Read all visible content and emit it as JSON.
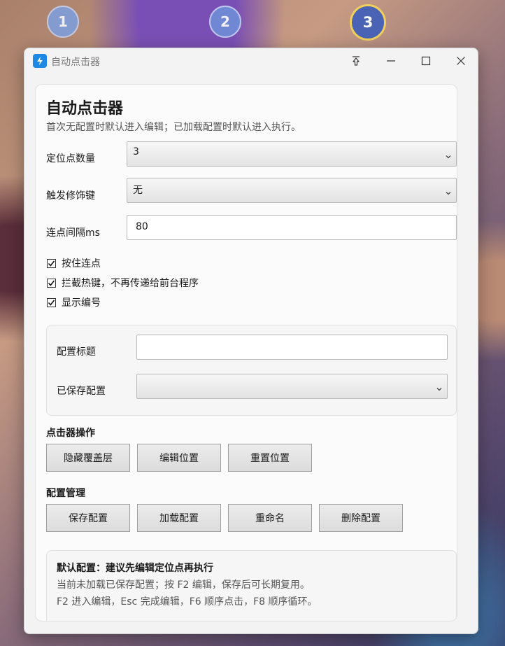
{
  "markers": [
    "1",
    "2",
    "3"
  ],
  "window": {
    "title": "自动点击器",
    "icon": "lightning-icon"
  },
  "header": {
    "title": "自动点击器",
    "subtitle": "首次无配置时默认进入编辑；已加载配置时默认进入执行。"
  },
  "fields": {
    "point_count_label": "定位点数量",
    "point_count_value": "3",
    "modifier_label": "触发修饰键",
    "modifier_value": "无",
    "interval_label": "连点间隔ms",
    "interval_value": "80"
  },
  "checkboxes": [
    {
      "label": "按住连点",
      "checked": true
    },
    {
      "label": "拦截热键，不再传递给前台程序",
      "checked": true
    },
    {
      "label": "显示编号",
      "checked": true
    }
  ],
  "config": {
    "title_label": "配置标题",
    "title_value": "",
    "saved_label": "已保存配置",
    "saved_value": ""
  },
  "clicker_ops": {
    "title": "点击器操作",
    "buttons": [
      "隐藏覆盖层",
      "编辑位置",
      "重置位置"
    ]
  },
  "config_mgmt": {
    "title": "配置管理",
    "buttons": [
      "保存配置",
      "加载配置",
      "重命名",
      "删除配置"
    ]
  },
  "info": {
    "title": "默认配置：建议先编辑定位点再执行",
    "line1": "当前未加载已保存配置；按 F2 编辑，保存后可长期复用。",
    "line2": "F2 进入编辑，Esc 完成编辑，F6 顺序点击，F8 顺序循环。"
  }
}
